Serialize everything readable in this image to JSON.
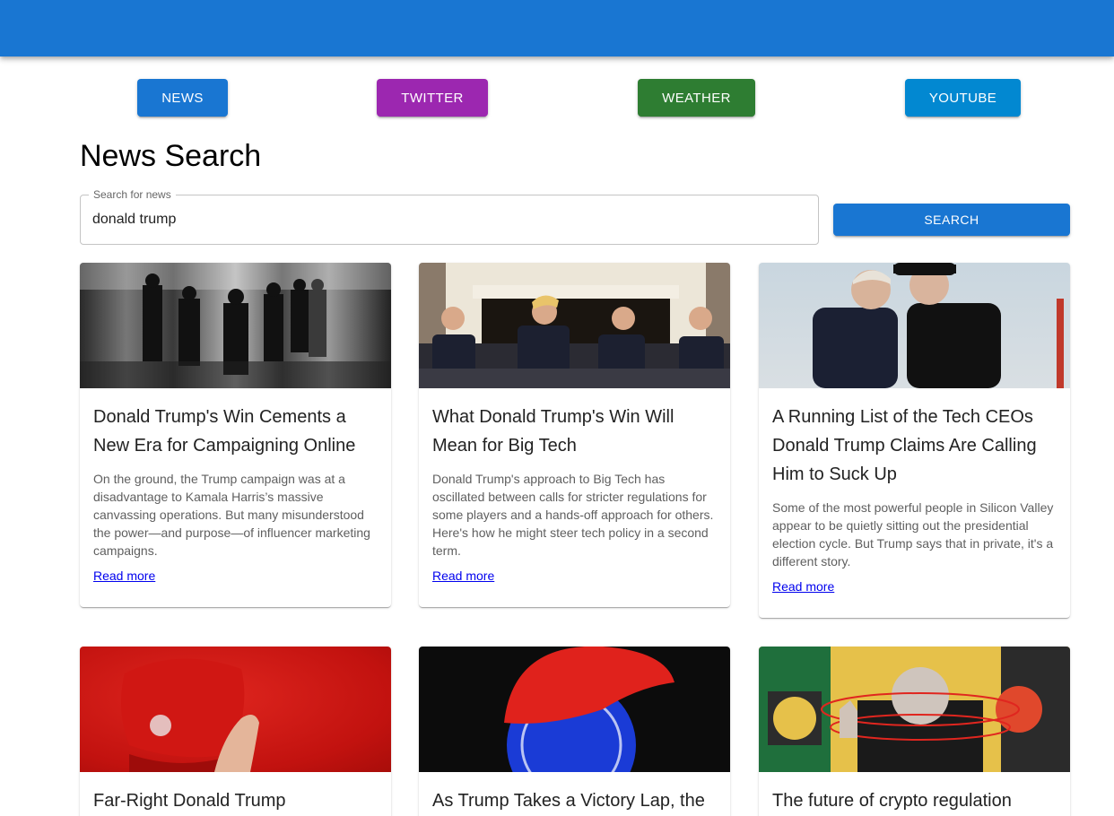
{
  "nav": {
    "news": "NEWS",
    "twitter": "TWITTER",
    "weather": "WEATHER",
    "youtube": "YOUTUBE"
  },
  "colors": {
    "appbar": "#1976d2",
    "news": "#1976d2",
    "twitter": "#9c27b0",
    "weather": "#2e7d32",
    "youtube": "#0288d1"
  },
  "page": {
    "title": "News Search"
  },
  "search": {
    "label": "Search for news",
    "value": "donald trump",
    "button": "SEARCH"
  },
  "articles": [
    {
      "title": "Donald Trump's Win Cements a New Era for Campaigning Online",
      "description": "On the ground, the Trump campaign was at a disadvantage to Kamala Harris’s massive canvassing operations. But many misunderstood the power—and purpose—of influencer marketing campaigns.",
      "link": "Read more",
      "image": "crowd-on-stage-photo"
    },
    {
      "title": "What Donald Trump's Win Will Mean for Big Tech",
      "description": "Donald Trump's approach to Big Tech has oscillated between calls for stricter regulations for some players and a hands-off approach for others. Here's how he might steer tech policy in a second term.",
      "link": "Read more",
      "image": "meeting-by-fireplace-photo"
    },
    {
      "title": "A Running List of the Tech CEOs Donald Trump Claims Are Calling Him to Suck Up",
      "description": "Some of the most powerful people in Silicon Valley appear to be quietly sitting out the presidential election cycle. But Trump says that in private, it's a different story.",
      "link": "Read more",
      "image": "two-men-talking-photo"
    },
    {
      "title": "Far-Right Donald Trump",
      "image": "red-maga-cap-photo"
    },
    {
      "title": "As Trump Takes a Victory Lap, the",
      "image": "cap-on-coin-illustration"
    },
    {
      "title": "The future of crypto regulation",
      "image": "crypto-collage-illustration"
    }
  ]
}
